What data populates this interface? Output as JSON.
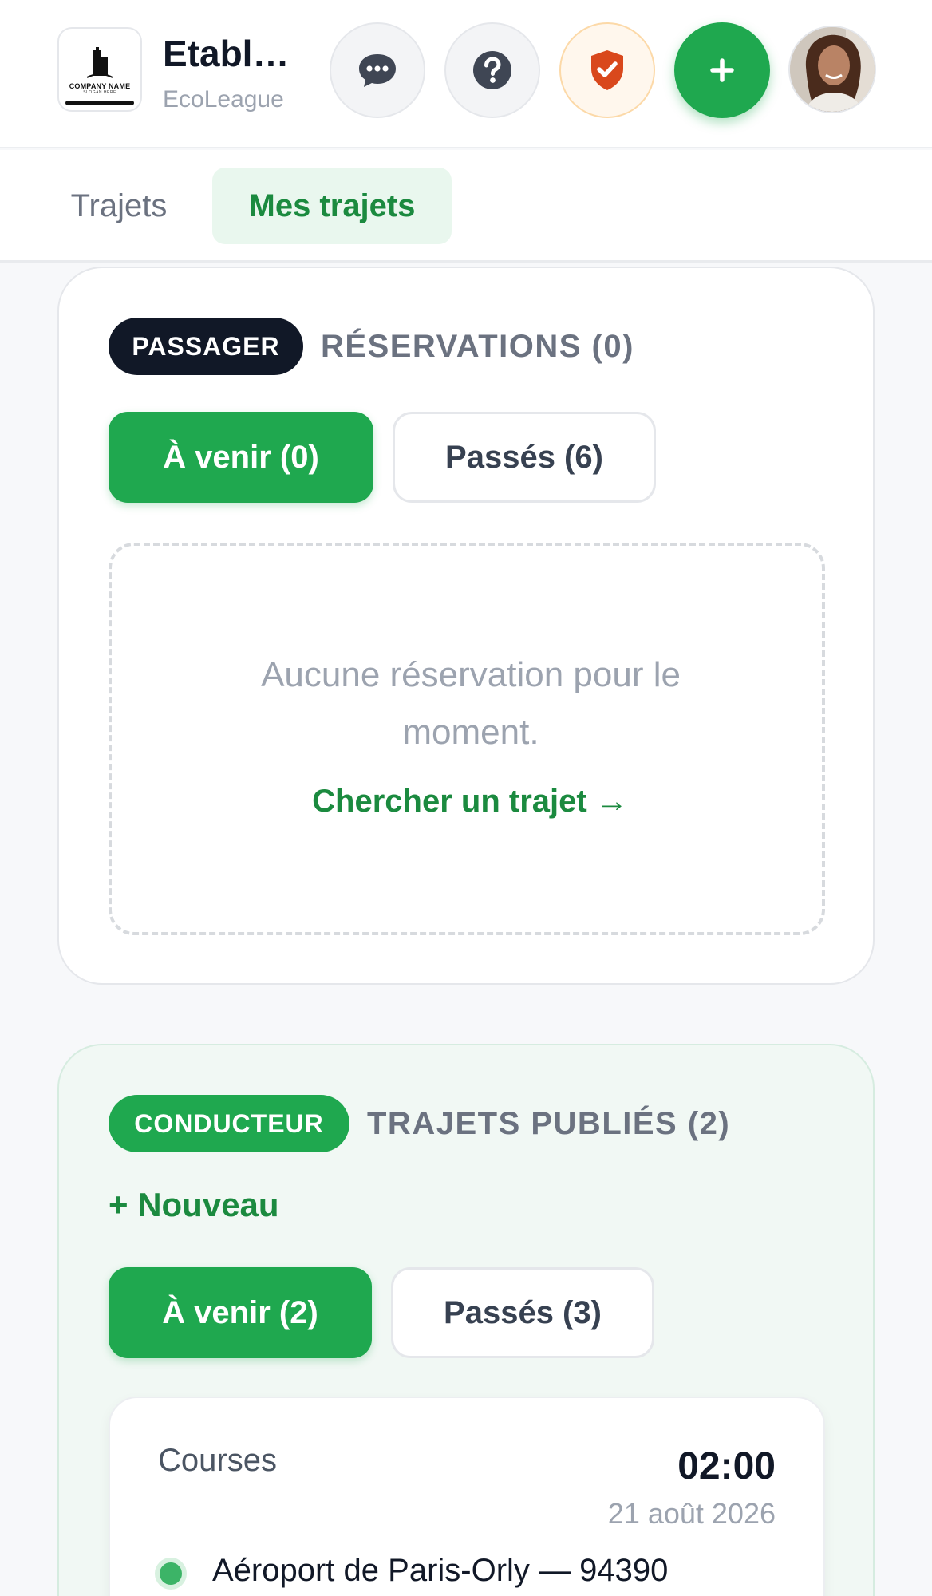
{
  "header": {
    "logo_text": "COMPANY NAME",
    "logo_slogan": "SLOGAN HERE",
    "org_title": "Etablissement",
    "org_subtitle": "EcoLeague",
    "plus_label": "+"
  },
  "tabs": [
    {
      "label": "Trajets",
      "active": false
    },
    {
      "label": "Mes trajets",
      "active": true
    }
  ],
  "passenger": {
    "badge": "PASSAGER",
    "title": "RÉSERVATIONS (0)",
    "segments": [
      {
        "label": "À venir (0)",
        "active": true
      },
      {
        "label": "Passés (6)",
        "active": false
      }
    ],
    "empty_message": "Aucune réservation pour le moment.",
    "empty_link": "Chercher un trajet →"
  },
  "driver": {
    "badge": "CONDUCTEUR",
    "title": "TRAJETS PUBLIÉS (2)",
    "new_link": "+ Nouveau",
    "segments": [
      {
        "label": "À venir (2)",
        "active": true
      },
      {
        "label": "Passés (3)",
        "active": false
      }
    ],
    "trips": [
      {
        "type": "Courses",
        "time": "02:00",
        "date": "21 août 2026",
        "from": "Aéroport de Paris-Orly — 94390"
      }
    ]
  },
  "colors": {
    "primary_green": "#1fa84f",
    "link_green": "#1b8a3f",
    "passenger_badge": "#111827",
    "shield_red": "#d9481c"
  },
  "icons": {
    "chat": "chat-bubble-icon",
    "help": "question-icon",
    "shield": "shield-check-icon",
    "add": "plus-icon"
  }
}
